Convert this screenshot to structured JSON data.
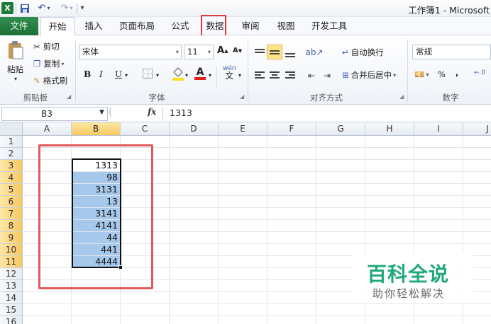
{
  "window": {
    "title": "工作簿1 - Microsoft"
  },
  "quick_access": {
    "logo": "X",
    "undo": "↶",
    "redo": "↷",
    "customize": "▾"
  },
  "tabs": {
    "file": "文件",
    "home": "开始",
    "insert": "插入",
    "page_layout": "页面布局",
    "formulas": "公式",
    "data": "数据",
    "review": "审阅",
    "view": "视图",
    "developer": "开发工具"
  },
  "ribbon": {
    "clipboard": {
      "label": "剪贴板",
      "paste": "粘贴",
      "cut": "剪切",
      "copy": "复制",
      "format_painter": "格式刷"
    },
    "font": {
      "label": "字体",
      "name": "宋体",
      "size": "11",
      "bold": "B",
      "italic": "I",
      "underline": "U",
      "grow": "A",
      "shrink": "A",
      "font_color": "A",
      "phonetic": "wén"
    },
    "alignment": {
      "label": "对齐方式",
      "wrap_text": "自动换行",
      "merge_center": "合并后居中"
    },
    "number": {
      "label": "数字",
      "format": "常规",
      "percent": "%",
      "comma": ","
    }
  },
  "formula_bar": {
    "name_box": "B3",
    "fx": "fx",
    "value": "1313"
  },
  "grid": {
    "columns": [
      "A",
      "B",
      "C",
      "D",
      "E",
      "F",
      "G",
      "H",
      "I",
      "J"
    ],
    "rows": [
      "1",
      "2",
      "3",
      "4",
      "5",
      "6",
      "7",
      "8",
      "9",
      "10",
      "11",
      "12",
      "13",
      "14",
      "15",
      "16"
    ],
    "column_b_values": [
      "1313",
      "98",
      "3131",
      "13",
      "3141",
      "4141",
      "44",
      "441",
      "4444"
    ]
  },
  "watermark": {
    "title": "百科全说",
    "subtitle": "助你轻松解决"
  },
  "colors": {
    "accent": "#1f7a3a",
    "selection": "#a6c8ea",
    "annotation": "#e33b3b",
    "watermark": "#1fa87a"
  }
}
